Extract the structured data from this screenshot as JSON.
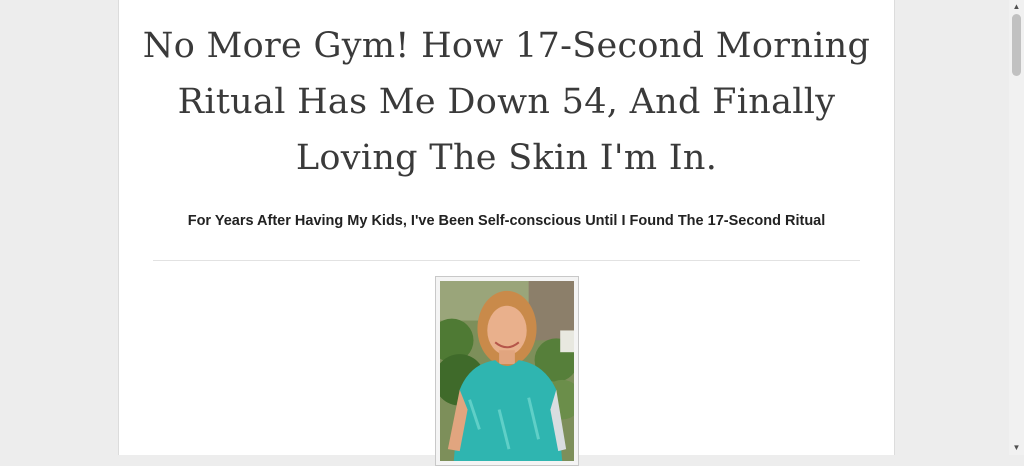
{
  "article": {
    "headline": "No More Gym! How 17-Second Morning Ritual Has Me Down 54, And Finally Loving The Skin I'm In.",
    "subheadline": "For Years After Having My Kids, I've Been Self-conscious Until I Found The 17-Second Ritual",
    "photo_alt": "woman-in-teal-top-outdoors"
  },
  "scrollbar": {
    "up_icon": "▲",
    "down_icon": "▼"
  },
  "colors": {
    "background": "#ededed",
    "page": "#ffffff",
    "headline": "#3a3a3a",
    "shirt": "#2fb5b0"
  }
}
